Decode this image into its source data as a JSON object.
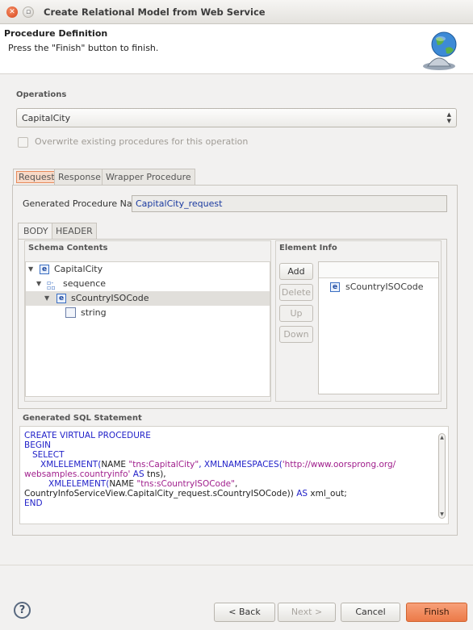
{
  "window": {
    "title": "Create Relational Model from Web Service"
  },
  "header": {
    "title": "Procedure Definition",
    "subtitle": "Press the \"Finish\" button to finish."
  },
  "operations": {
    "label": "Operations",
    "selected": "CapitalCity",
    "overwrite_label": "Overwrite existing procedures for this operation"
  },
  "tabs": [
    "Request",
    "Response",
    "Wrapper Procedure"
  ],
  "request": {
    "generated_name_label": "Generated Procedure Name",
    "generated_name_value": "CapitalCity_request",
    "subtabs": [
      "BODY",
      "HEADER"
    ],
    "schema_contents_label": "Schema Contents",
    "schema_tree": [
      "CapitalCity",
      "sequence",
      "sCountryISOCode",
      "string"
    ],
    "element_info_label": "Element Info",
    "buttons": {
      "add": "Add",
      "delete": "Delete",
      "up": "Up",
      "down": "Down"
    },
    "element_info_items": [
      "sCountryISOCode"
    ]
  },
  "sql": {
    "label": "Generated SQL Statement",
    "l1": "CREATE VIRTUAL PROCEDURE",
    "l2": "BEGIN",
    "l3": "   SELECT",
    "l4a": "      XMLELEMENT(",
    "l4b": "NAME ",
    "l4c": "\"tns:CapitalCity\"",
    "l4d": ", XMLNAMESPACES(",
    "l4e": "'http://www.oorsprong.org/",
    "l5a": "websamples.countryinfo'",
    "l5b": " AS ",
    "l5c": "tns),",
    "l6a": "         XMLELEMENT(",
    "l6b": "NAME ",
    "l6c": "\"tns:sCountryISOCode\"",
    "l6d": ",",
    "l7a": "CountryInfoServiceView.CapitalCity_request.sCountryISOCode))",
    "l7b": " AS ",
    "l7c": "xml_out;",
    "l8": "END"
  },
  "footer": {
    "help": "?",
    "back": "< Back",
    "next": "Next >",
    "cancel": "Cancel",
    "finish": "Finish"
  }
}
